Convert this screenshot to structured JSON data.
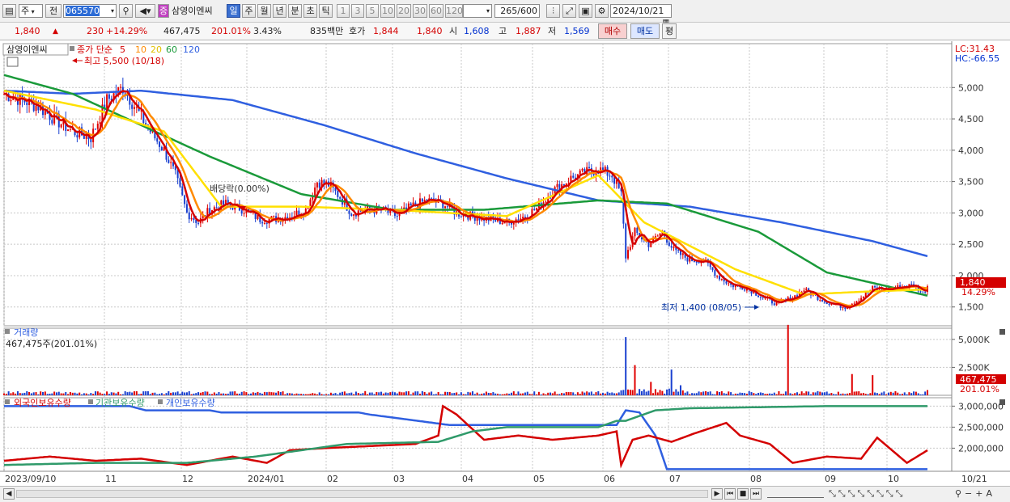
{
  "toolbar": {
    "period_select": "주",
    "prev_label": "전",
    "code": "065570",
    "company_badge": "증",
    "company": "삼영이엔씨",
    "periods": [
      "일",
      "주",
      "월",
      "년",
      "분",
      "초",
      "틱"
    ],
    "active_period": "일",
    "intervals": [
      "1",
      "3",
      "5",
      "10",
      "20",
      "30",
      "60",
      "120"
    ],
    "count": "265",
    "count_total": "/600",
    "date": "2024/10/21"
  },
  "quote": {
    "price": "1,840",
    "change": "230",
    "change_rate": "+14.29%",
    "volume": "467,475",
    "volume_rate": "201.01%",
    "turnover": "3.43%",
    "amount": "835백만",
    "bid_label": "호가",
    "bid_price": "1,844",
    "last": "1,840",
    "open_label": "시",
    "open": "1,608",
    "high_label": "고",
    "high": "1,887",
    "low_label": "저",
    "low": "1,569",
    "buy_label": "매수",
    "sell_label": "매도",
    "eval_label": "평"
  },
  "price_panel": {
    "name": "삼영이엔씨",
    "ma_legend_prefix": "종가 단순",
    "ma_periods": [
      "5",
      "10",
      "20",
      "60",
      "120"
    ],
    "ma_colors": [
      "#d40000",
      "#ff8a00",
      "#ffe000",
      "#1a9a3a",
      "#2f5fe0"
    ],
    "lc": "LC:31.43",
    "hc": "HC:-66.55",
    "high_annot": "최고 5,500 (10/18)",
    "low_annot": "최저 1,400 (08/05)",
    "div_annot": "배당락(0.00%)",
    "current_price_tag": "1,840",
    "current_rate_tag": "14.29%"
  },
  "volume_panel": {
    "title": "거래량",
    "value": "467,475주(201.01%)",
    "tag": "467,475",
    "tag2": "201.01%"
  },
  "holding_panel": {
    "legends": [
      "외국인보유수량",
      "기관보유수량",
      "개인보유수량"
    ]
  },
  "xaxis": {
    "labels": [
      "2023/09/10",
      "11",
      "12",
      "2024/01",
      "02",
      "03",
      "04",
      "05",
      "06",
      "07",
      "08",
      "09",
      "10"
    ],
    "end": "10/21"
  },
  "chart_data": [
    {
      "type": "candlestick",
      "ylim": [
        1200,
        5700
      ],
      "yticks": [
        1500,
        2000,
        2500,
        3000,
        3500,
        4000,
        4500,
        5000
      ],
      "ytick_labels": [
        "1,500",
        "2,000",
        "2,500",
        "3,000",
        "3,500",
        "4,000",
        "4,500",
        "5,000"
      ],
      "approx_close_path": [
        [
          0,
          4900
        ],
        [
          8,
          4800
        ],
        [
          15,
          4700
        ],
        [
          22,
          4500
        ],
        [
          30,
          4300
        ],
        [
          38,
          4200
        ],
        [
          45,
          4800
        ],
        [
          52,
          5000
        ],
        [
          58,
          4650
        ],
        [
          64,
          4300
        ],
        [
          70,
          4000
        ],
        [
          75,
          3600
        ],
        [
          80,
          3000
        ],
        [
          85,
          2850
        ],
        [
          90,
          3050
        ],
        [
          97,
          3150
        ],
        [
          105,
          3050
        ],
        [
          112,
          2900
        ],
        [
          118,
          2900
        ],
        [
          125,
          2950
        ],
        [
          132,
          3050
        ],
        [
          137,
          3500
        ],
        [
          142,
          3450
        ],
        [
          147,
          3250
        ],
        [
          152,
          3000
        ],
        [
          158,
          3050
        ],
        [
          165,
          3050
        ],
        [
          172,
          2950
        ],
        [
          178,
          3100
        ],
        [
          185,
          3200
        ],
        [
          192,
          3150
        ],
        [
          198,
          3000
        ],
        [
          205,
          2950
        ],
        [
          212,
          2900
        ],
        [
          220,
          2850
        ],
        [
          228,
          2950
        ],
        [
          234,
          3100
        ],
        [
          240,
          3350
        ],
        [
          248,
          3550
        ],
        [
          255,
          3650
        ],
        [
          260,
          3700
        ],
        [
          266,
          3600
        ],
        [
          270,
          3300
        ],
        [
          272,
          2300
        ],
        [
          276,
          2700
        ],
        [
          282,
          2500
        ],
        [
          288,
          2700
        ],
        [
          293,
          2400
        ],
        [
          300,
          2250
        ],
        [
          306,
          2250
        ],
        [
          312,
          2000
        ],
        [
          318,
          1850
        ],
        [
          325,
          1800
        ],
        [
          332,
          1650
        ],
        [
          338,
          1550
        ],
        [
          345,
          1650
        ],
        [
          350,
          1780
        ],
        [
          356,
          1650
        ],
        [
          362,
          1550
        ],
        [
          368,
          1500
        ],
        [
          375,
          1650
        ],
        [
          380,
          1800
        ],
        [
          386,
          1780
        ],
        [
          392,
          1820
        ],
        [
          398,
          1850
        ],
        [
          402,
          1720
        ],
        [
          404,
          1840
        ]
      ],
      "ma120_path": [
        [
          0,
          4950
        ],
        [
          30,
          4900
        ],
        [
          60,
          4950
        ],
        [
          100,
          4800
        ],
        [
          140,
          4400
        ],
        [
          180,
          3950
        ],
        [
          220,
          3550
        ],
        [
          260,
          3200
        ],
        [
          300,
          3100
        ],
        [
          340,
          2850
        ],
        [
          380,
          2550
        ],
        [
          404,
          2310
        ]
      ],
      "ma60_path": [
        [
          0,
          5200
        ],
        [
          30,
          4900
        ],
        [
          60,
          4400
        ],
        [
          90,
          3900
        ],
        [
          130,
          3300
        ],
        [
          170,
          3050
        ],
        [
          210,
          3050
        ],
        [
          260,
          3200
        ],
        [
          290,
          3150
        ],
        [
          330,
          2700
        ],
        [
          360,
          2050
        ],
        [
          390,
          1800
        ],
        [
          404,
          1680
        ]
      ],
      "ma20_path": [
        [
          0,
          4950
        ],
        [
          40,
          4650
        ],
        [
          70,
          4300
        ],
        [
          95,
          3100
        ],
        [
          130,
          3100
        ],
        [
          170,
          3050
        ],
        [
          220,
          2950
        ],
        [
          260,
          3600
        ],
        [
          280,
          2850
        ],
        [
          320,
          2100
        ],
        [
          350,
          1700
        ],
        [
          380,
          1750
        ],
        [
          404,
          1780
        ]
      ],
      "n_days": 405
    },
    {
      "type": "bar",
      "name": "거래량",
      "ylim": [
        0,
        6000000
      ],
      "yticks": [
        2500000,
        5000000
      ],
      "ytick_labels": [
        "2,500K",
        "5,000K"
      ],
      "spikes": [
        [
          272,
          5200000
        ],
        [
          276,
          2700000
        ],
        [
          283,
          1200000
        ],
        [
          292,
          2300000
        ],
        [
          296,
          900000
        ],
        [
          343,
          6300000
        ],
        [
          371,
          1900000
        ],
        [
          380,
          1800000
        ],
        [
          404,
          467475
        ]
      ],
      "baseline": 250000
    },
    {
      "type": "line",
      "name": "보유수량",
      "ylim": [
        1450000,
        3200000
      ],
      "yticks": [
        2000000,
        2500000,
        3000000
      ],
      "ytick_labels": [
        "2,000,000",
        "2,500,000",
        "3,000,000"
      ],
      "series": [
        {
          "name": "외국인보유수량",
          "color": "#2f5fe0",
          "points": [
            [
              0,
              3000000
            ],
            [
              55,
              3000000
            ],
            [
              62,
              2900000
            ],
            [
              90,
              2900000
            ],
            [
              95,
              2850000
            ],
            [
              155,
              2850000
            ],
            [
              160,
              2800000
            ],
            [
              195,
              2550000
            ],
            [
              268,
              2550000
            ],
            [
              272,
              2900000
            ],
            [
              278,
              2850000
            ],
            [
              285,
              2300000
            ],
            [
              290,
              1500000
            ],
            [
              404,
              1500000
            ]
          ]
        },
        {
          "name": "기관보유수량",
          "color": "#d40000",
          "points": [
            [
              0,
              1700000
            ],
            [
              20,
              1800000
            ],
            [
              40,
              1700000
            ],
            [
              60,
              1750000
            ],
            [
              80,
              1600000
            ],
            [
              100,
              1800000
            ],
            [
              115,
              1650000
            ],
            [
              125,
              1950000
            ],
            [
              140,
              2000000
            ],
            [
              160,
              2050000
            ],
            [
              180,
              2100000
            ],
            [
              190,
              2300000
            ],
            [
              192,
              3000000
            ],
            [
              198,
              2800000
            ],
            [
              210,
              2200000
            ],
            [
              225,
              2300000
            ],
            [
              240,
              2200000
            ],
            [
              260,
              2300000
            ],
            [
              268,
              2400000
            ],
            [
              270,
              1600000
            ],
            [
              275,
              2200000
            ],
            [
              282,
              2300000
            ],
            [
              292,
              2150000
            ],
            [
              302,
              2350000
            ],
            [
              316,
              2600000
            ],
            [
              322,
              2300000
            ],
            [
              335,
              2100000
            ],
            [
              345,
              1650000
            ],
            [
              360,
              1800000
            ],
            [
              375,
              1750000
            ],
            [
              382,
              2250000
            ],
            [
              395,
              1650000
            ],
            [
              404,
              1950000
            ]
          ]
        },
        {
          "name": "개인보유수량",
          "color": "#2f9a6a",
          "points": [
            [
              0,
              1600000
            ],
            [
              40,
              1650000
            ],
            [
              80,
              1650000
            ],
            [
              110,
              1800000
            ],
            [
              150,
              2100000
            ],
            [
              190,
              2150000
            ],
            [
              205,
              2400000
            ],
            [
              220,
              2500000
            ],
            [
              260,
              2500000
            ],
            [
              268,
              2650000
            ],
            [
              272,
              2650000
            ],
            [
              285,
              2900000
            ],
            [
              300,
              2950000
            ],
            [
              360,
              3000000
            ],
            [
              404,
              3000000
            ]
          ]
        }
      ]
    }
  ]
}
